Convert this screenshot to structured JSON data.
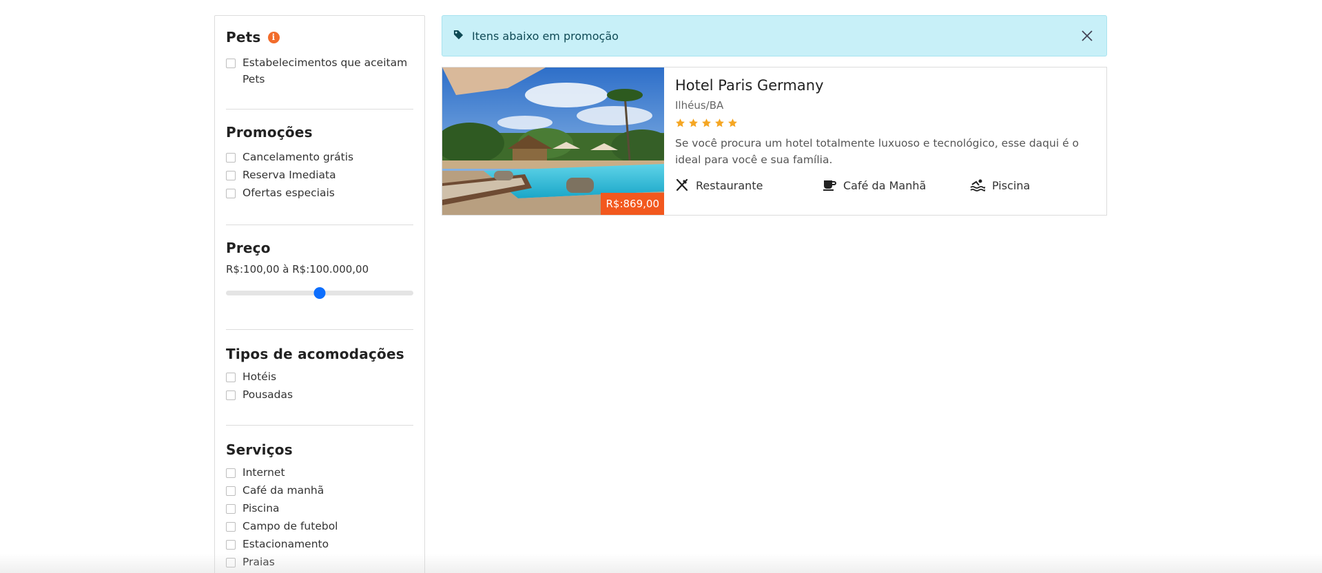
{
  "filters": {
    "pets": {
      "title": "Pets",
      "info_icon": "info-icon",
      "options": [
        "Estabelecimentos que aceitam Pets"
      ]
    },
    "promocoes": {
      "title": "Promoções",
      "options": [
        "Cancelamento grátis",
        "Reserva Imediata",
        "Ofertas especiais"
      ]
    },
    "preco": {
      "title": "Preço",
      "range_text": "R$:100,00 à R$:100.000,00",
      "slider_fraction": 0.5
    },
    "tipos": {
      "title": "Tipos de acomodações",
      "options": [
        "Hotéis",
        "Pousadas"
      ]
    },
    "servicos": {
      "title": "Serviços",
      "options": [
        "Internet",
        "Café da manhã",
        "Piscina",
        "Campo de futebol",
        "Estacionamento",
        "Praias"
      ]
    }
  },
  "promo_banner": {
    "text": "Itens abaixo em promoção",
    "icon": "tag-icon",
    "close_icon": "close-icon"
  },
  "hotel": {
    "name": "Hotel Paris Germany",
    "location": "Ilhéus/BA",
    "stars": 5,
    "description": "Se você procura um hotel totalmente luxuoso e tecnológico, esse daqui é o ideal para você e sua família.",
    "price": "R$:869,00",
    "amenities": [
      {
        "label": "Restaurante",
        "icon": "utensils-icon"
      },
      {
        "label": "Café da Manhã",
        "icon": "coffee-icon"
      },
      {
        "label": "Piscina",
        "icon": "pool-icon"
      }
    ]
  },
  "colors": {
    "accent_orange": "#f2581e",
    "star": "#f5a623",
    "promo_bg": "#c8f0f8",
    "slider": "#0d6efd"
  }
}
